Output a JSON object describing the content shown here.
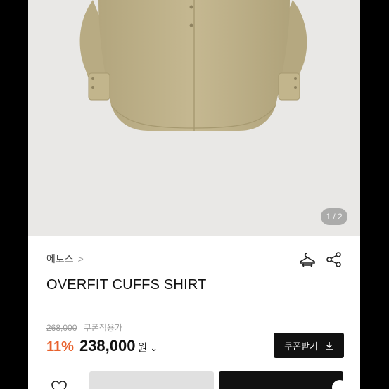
{
  "gallery": {
    "page_indicator": "1 / 2",
    "image_alt": "OVERFIT CUFFS SHIRT product photo",
    "shirt_color": "#c1b48c"
  },
  "product": {
    "brand": "에토스",
    "brand_chevron": ">",
    "name": "OVERFIT CUFFS SHIRT",
    "original_price": "268,000",
    "coupon_price_label": "쿠폰적용가",
    "discount": "11%",
    "price": "238,000",
    "currency": "원",
    "price_chevron": "⌄",
    "accent_color": "#e8622d"
  },
  "actions": {
    "coupon_button_label": "쿠폰받기",
    "icons": [
      "hanger-icon",
      "share-icon",
      "download-icon",
      "heart-icon"
    ]
  }
}
